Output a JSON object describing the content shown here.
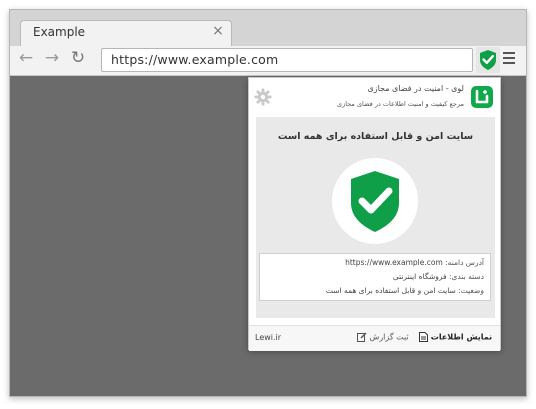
{
  "window": {
    "tab_title": "Example",
    "tab_close": "×"
  },
  "toolbar": {
    "back": "←",
    "forward": "→",
    "reload": "↻",
    "url": "https://www.example.com",
    "extension_icon": "green-shield-check-icon",
    "menu_icon": "hamburger-menu-icon"
  },
  "popup": {
    "brand_title": "لوی - امنیت در فضای مجازی",
    "brand_subtitle": "مرجع کیفیت و امنیت اطلاعات در فضای مجازی",
    "verdict": "سایت امن و قابل استفاده برای همه است",
    "info": {
      "domain_label": "آدرس دامنه:",
      "domain_value": "https://www.example.com",
      "category_label": "دسته بندی:",
      "category_value": "فروشگاه اینترنتی",
      "status_label": "وضعیت:",
      "status_value": "سایت امن و قابل استفاده برای همه است"
    },
    "footer": {
      "site": "Lewi.ir",
      "report": "ثبت گزارش",
      "show_info": "نمایش اطلاعات"
    }
  },
  "colors": {
    "accent_green": "#10a84b",
    "shield_green": "#0e9f48",
    "browser_content": "#6b6b6b"
  }
}
